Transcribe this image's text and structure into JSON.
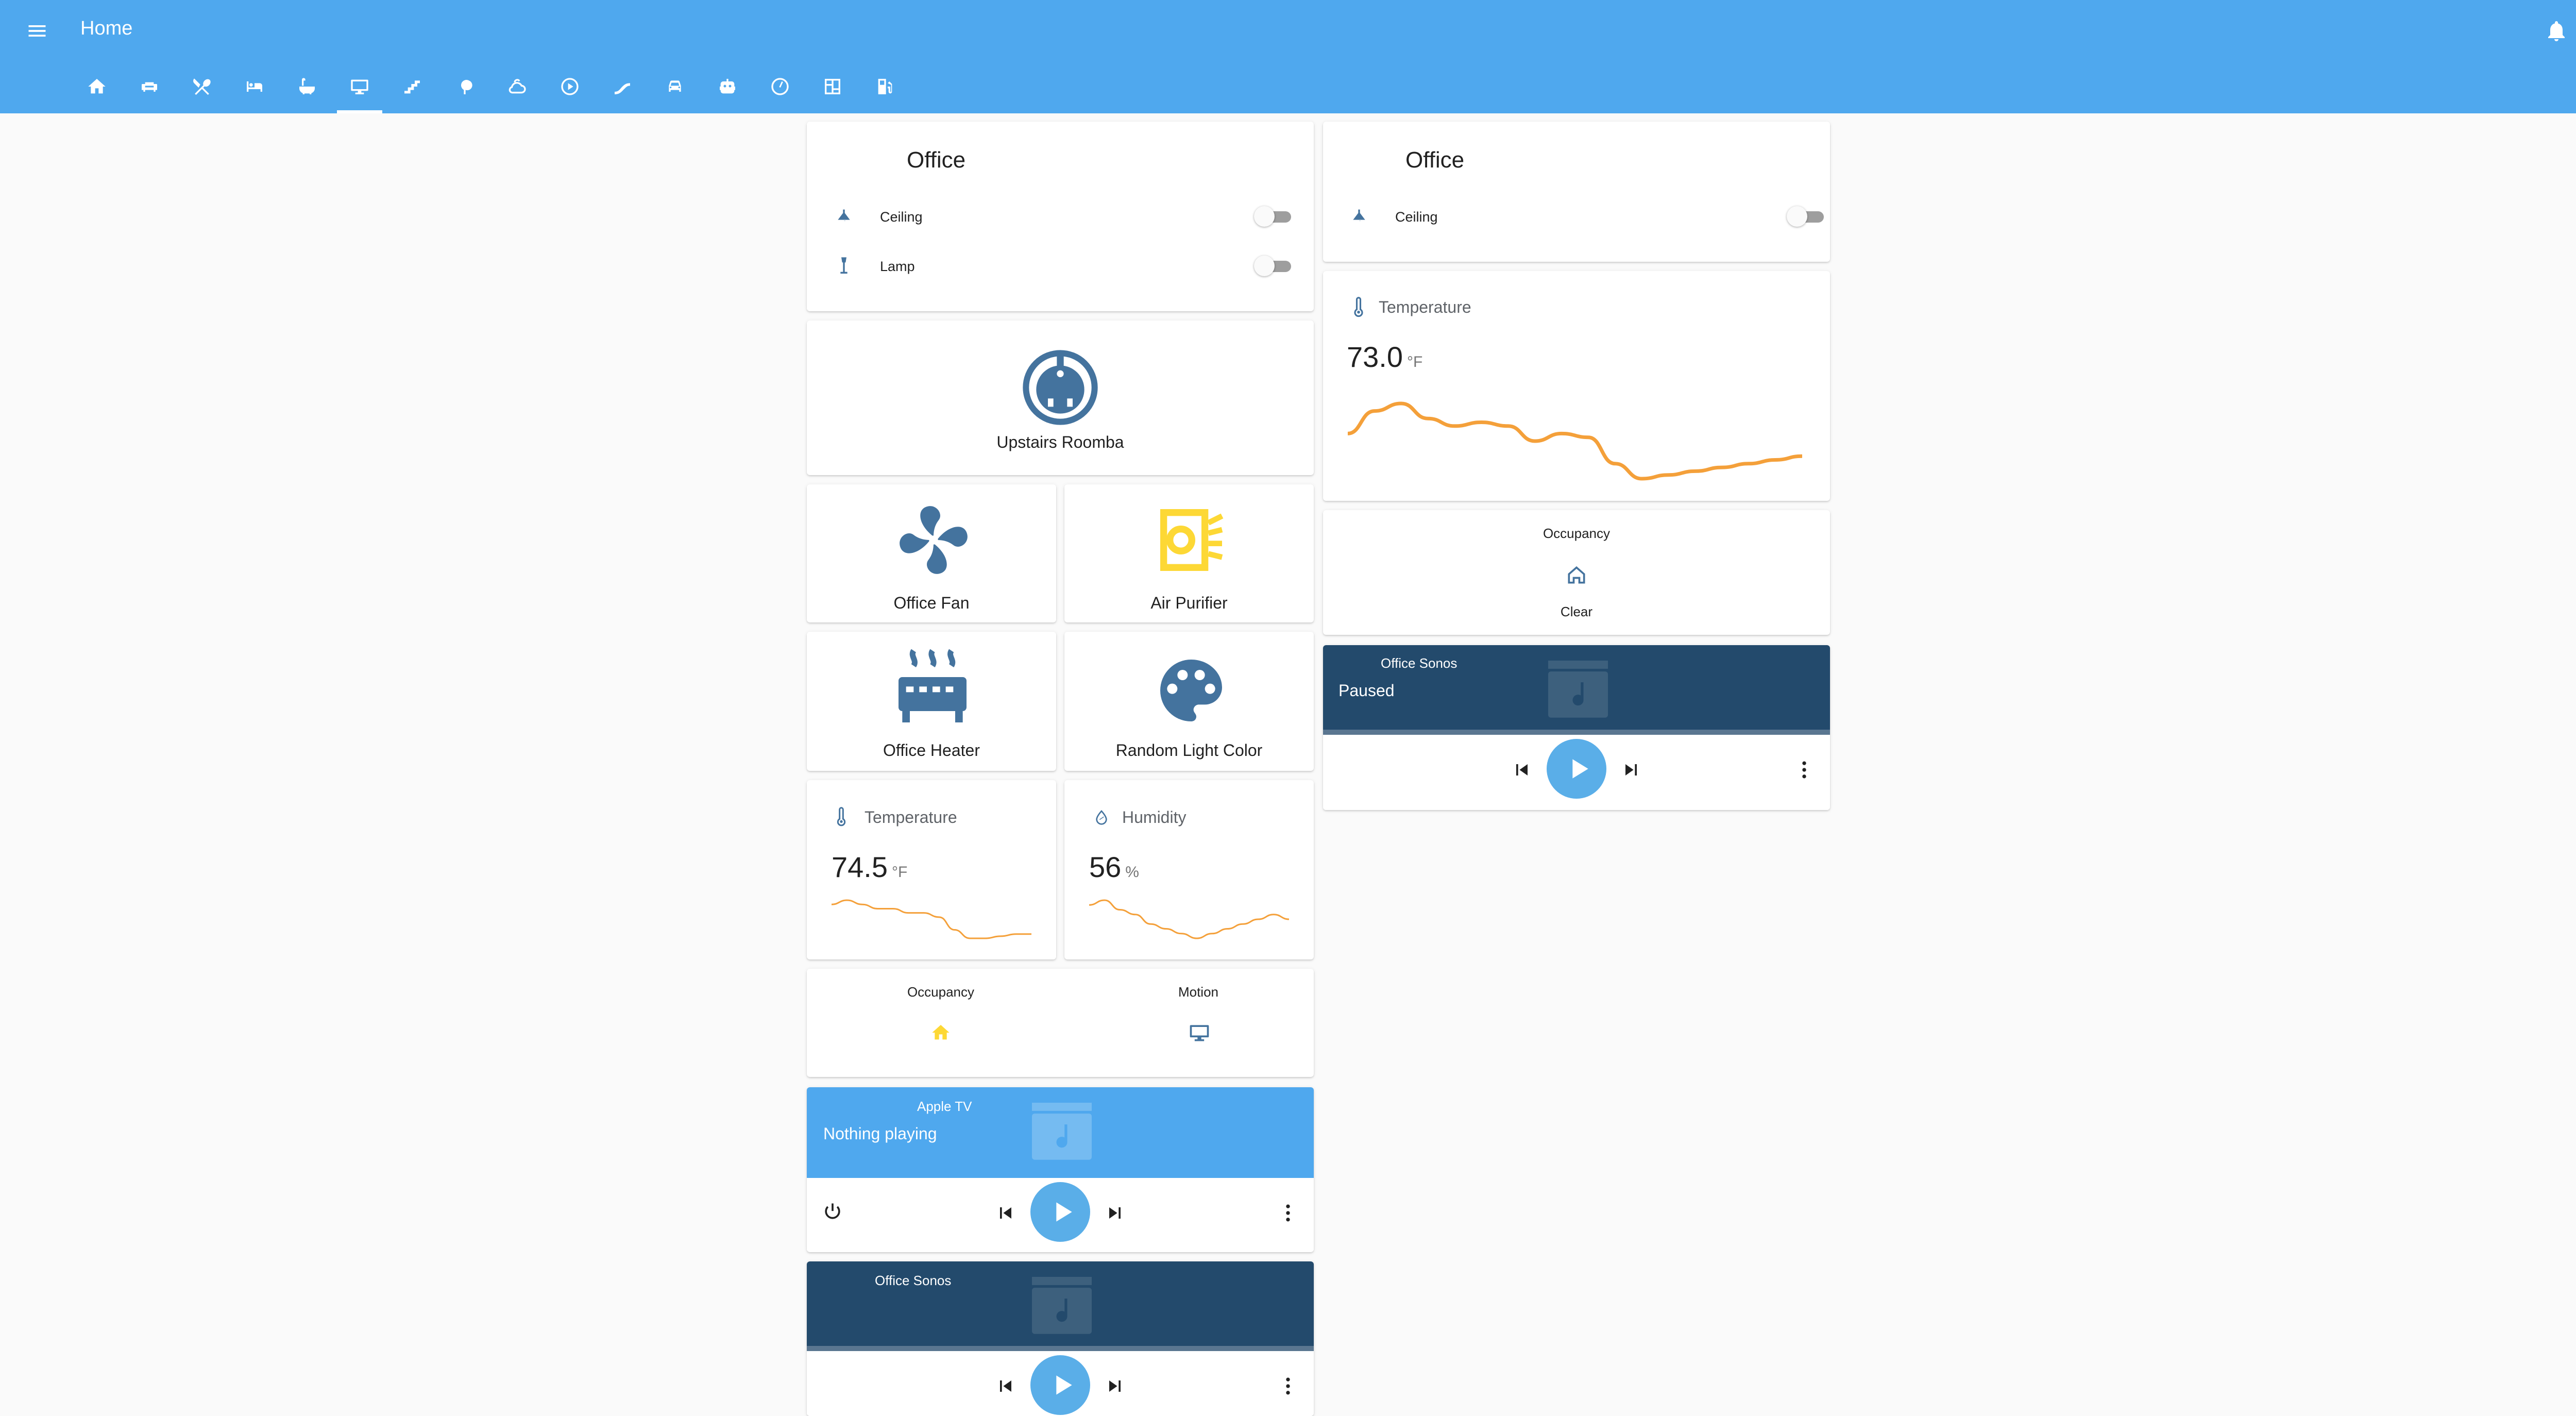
{
  "header": {
    "title": "Home",
    "tabs": [
      "home-icon",
      "sofa-icon",
      "utensils-icon",
      "bed-icon",
      "bathtub-icon",
      "monitor-icon",
      "stairs-icon",
      "tree-icon",
      "weather-icon",
      "play-circle-icon",
      "slide-icon",
      "car-icon",
      "robot-icon",
      "gauge-icon",
      "grid-icon",
      "gas-pump-icon"
    ],
    "active_tab_index": 5
  },
  "colors": {
    "primary": "#4fa8ee",
    "icon_blue": "#44739e",
    "accent_yellow": "#fdd835",
    "graph_orange": "#f4a03a",
    "media_dark": "#234a6c",
    "media_light": "#4fa8ee"
  },
  "left": {
    "office_card": {
      "title": "Office",
      "rows": [
        {
          "label": "Ceiling",
          "icon": "ceiling-light-icon",
          "on": false
        },
        {
          "label": "Lamp",
          "icon": "floor-lamp-icon",
          "on": false
        }
      ]
    },
    "roomba": {
      "name": "Upstairs Roomba",
      "icon": "robot-vacuum-icon"
    },
    "fan": {
      "name": "Office Fan",
      "icon": "fan-icon"
    },
    "purifier": {
      "name": "Air Purifier",
      "icon": "air-purifier-icon"
    },
    "heater": {
      "name": "Office Heater",
      "icon": "radiator-icon"
    },
    "random_color": {
      "name": "Random Light Color",
      "icon": "palette-icon"
    },
    "temperature": {
      "name": "Temperature",
      "value": "74.5",
      "unit": "°F",
      "history": [
        74.6,
        74.7,
        74.6,
        74.5,
        74.5,
        74.4,
        74.4,
        74.3,
        74.0,
        73.8,
        73.8,
        73.85,
        73.9,
        73.9
      ]
    },
    "humidity": {
      "name": "Humidity",
      "value": "56",
      "unit": "%",
      "history": [
        56.4,
        56.5,
        56.3,
        56.2,
        56.0,
        55.9,
        55.8,
        55.7,
        55.8,
        55.9,
        56.0,
        56.1,
        56.2,
        56.1
      ]
    },
    "glance": [
      {
        "label": "Occupancy",
        "icon": "home-icon"
      },
      {
        "label": "Motion",
        "icon": "monitor-icon"
      }
    ],
    "apple_tv": {
      "source": "Apple TV",
      "state": "Nothing playing"
    },
    "sonos": {
      "source": "Office Sonos"
    }
  },
  "right": {
    "office_card": {
      "title": "Office",
      "rows": [
        {
          "label": "Ceiling",
          "icon": "ceiling-light-icon",
          "on": false
        }
      ]
    },
    "temperature": {
      "name": "Temperature",
      "value": "73.0",
      "unit": "°F",
      "history": [
        73.2,
        73.5,
        73.6,
        73.4,
        73.3,
        73.35,
        73.3,
        73.1,
        73.2,
        73.15,
        72.8,
        72.6,
        72.65,
        72.7,
        72.75,
        72.8,
        72.85,
        72.9
      ]
    },
    "occupancy": {
      "label": "Occupancy",
      "state": "Clear"
    },
    "sonos": {
      "source": "Office Sonos",
      "state": "Paused"
    }
  }
}
